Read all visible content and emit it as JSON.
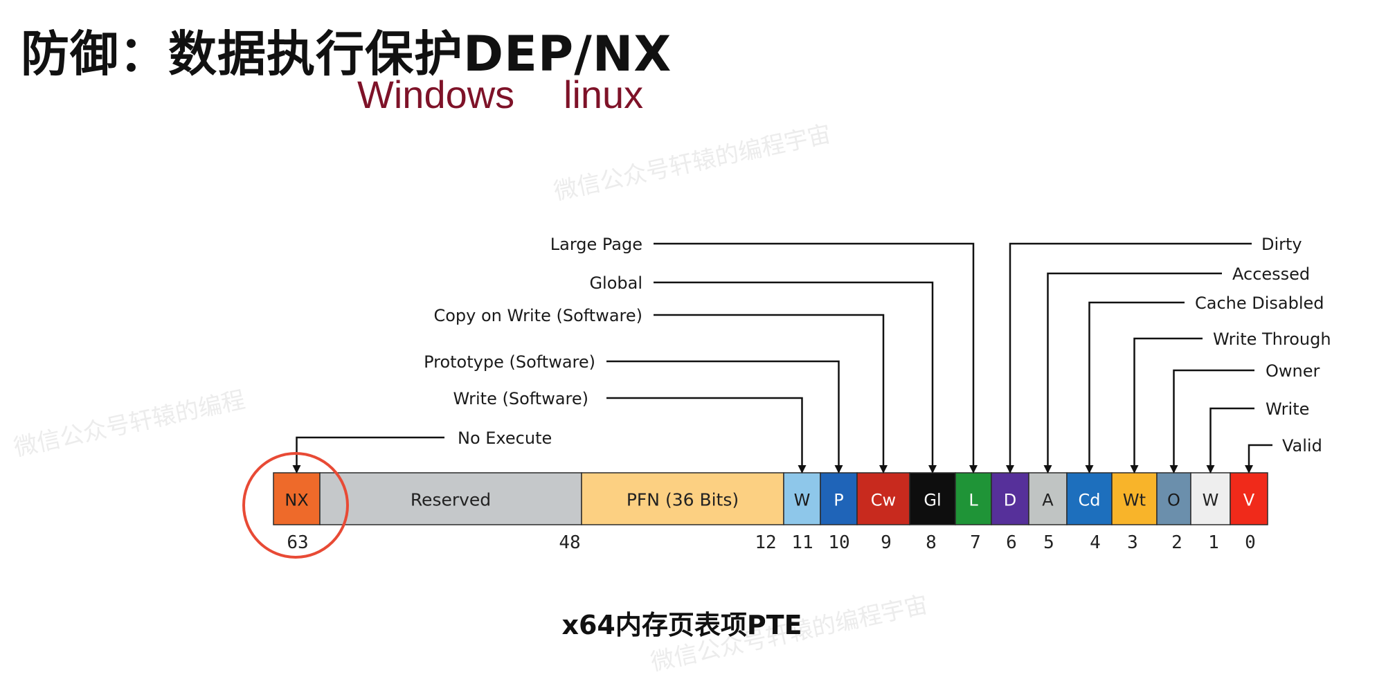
{
  "header": {
    "title": "防御：数据执行保护DEP/NX",
    "os_windows": "Windows",
    "os_linux": "linux"
  },
  "watermarks": [
    "微信公众号轩辕的编程宇宙",
    "微信公众号轩辕的编程",
    "微信公众号轩辕的编程宇宙"
  ],
  "pte": {
    "caption": "x64内存页表项PTE",
    "fields": [
      {
        "id": "nx",
        "text": "NX",
        "color": "#ee6a2a",
        "text_color": "#1a1a1a"
      },
      {
        "id": "reserved",
        "text": "Reserved",
        "color": "#c5c8ca",
        "text_color": "#222222"
      },
      {
        "id": "pfn",
        "text": "PFN (36 Bits)",
        "color": "#fcd082",
        "text_color": "#222222"
      },
      {
        "id": "w11",
        "text": "W",
        "color": "#8ec7ea",
        "text_color": "#1a1a1a"
      },
      {
        "id": "p",
        "text": "P",
        "color": "#1f64b8",
        "text_color": "#ffffff"
      },
      {
        "id": "cw",
        "text": "Cw",
        "color": "#c82a1e",
        "text_color": "#ffffff"
      },
      {
        "id": "gl",
        "text": "Gl",
        "color": "#0e0e0e",
        "text_color": "#ffffff"
      },
      {
        "id": "l",
        "text": "L",
        "color": "#1f9437",
        "text_color": "#ffffff"
      },
      {
        "id": "d",
        "text": "D",
        "color": "#56309a",
        "text_color": "#ffffff"
      },
      {
        "id": "a",
        "text": "A",
        "color": "#c0c4c3",
        "text_color": "#222222"
      },
      {
        "id": "cd",
        "text": "Cd",
        "color": "#1d6fbd",
        "text_color": "#ffffff"
      },
      {
        "id": "wt",
        "text": "Wt",
        "color": "#f8b42a",
        "text_color": "#222222"
      },
      {
        "id": "o",
        "text": "O",
        "color": "#6b8fac",
        "text_color": "#1a1a1a"
      },
      {
        "id": "w1",
        "text": "W",
        "color": "#eeeeee",
        "text_color": "#222222"
      },
      {
        "id": "v",
        "text": "V",
        "color": "#f02a1a",
        "text_color": "#ffffff"
      }
    ],
    "bit_labels": [
      "63",
      "48",
      "12",
      "11",
      "10",
      "9",
      "8",
      "7",
      "6",
      "5",
      "4",
      "3",
      "2",
      "1",
      "0"
    ],
    "annotations": [
      {
        "text": "Large Page",
        "field": "l"
      },
      {
        "text": "Global",
        "field": "gl"
      },
      {
        "text": "Copy on Write (Software)",
        "field": "cw"
      },
      {
        "text": "Prototype (Software)",
        "field": "p"
      },
      {
        "text": "Write (Software)",
        "field": "w11"
      },
      {
        "text": "No Execute",
        "field": "nx"
      },
      {
        "text": "Dirty",
        "field": "d"
      },
      {
        "text": "Accessed",
        "field": "a"
      },
      {
        "text": "Cache Disabled",
        "field": "cd"
      },
      {
        "text": "Write Through",
        "field": "wt"
      },
      {
        "text": "Owner",
        "field": "o"
      },
      {
        "text": "Write",
        "field": "w1"
      },
      {
        "text": "Valid",
        "field": "v"
      }
    ],
    "highlight": {
      "field": "nx",
      "color": "#e84a35"
    }
  }
}
